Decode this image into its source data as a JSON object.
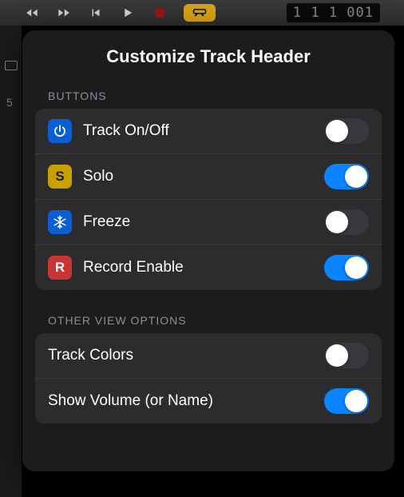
{
  "toolbar": {
    "time": "1 1 1 001"
  },
  "leftStrip": {
    "number": "5"
  },
  "popover": {
    "title": "Customize Track Header",
    "sections": [
      {
        "header": "BUTTONS",
        "rows": [
          {
            "iconClass": "icon-power",
            "iconType": "power",
            "label": "Track On/Off",
            "on": false
          },
          {
            "iconClass": "icon-solo",
            "iconType": "letter",
            "iconLetter": "S",
            "label": "Solo",
            "on": true
          },
          {
            "iconClass": "icon-freeze",
            "iconType": "snow",
            "label": "Freeze",
            "on": false
          },
          {
            "iconClass": "icon-record",
            "iconType": "letter",
            "iconLetter": "R",
            "label": "Record Enable",
            "on": true
          }
        ]
      },
      {
        "header": "OTHER VIEW OPTIONS",
        "rows": [
          {
            "label": "Track Colors",
            "on": false
          },
          {
            "label": "Show Volume (or Name)",
            "on": true
          }
        ]
      }
    ]
  }
}
